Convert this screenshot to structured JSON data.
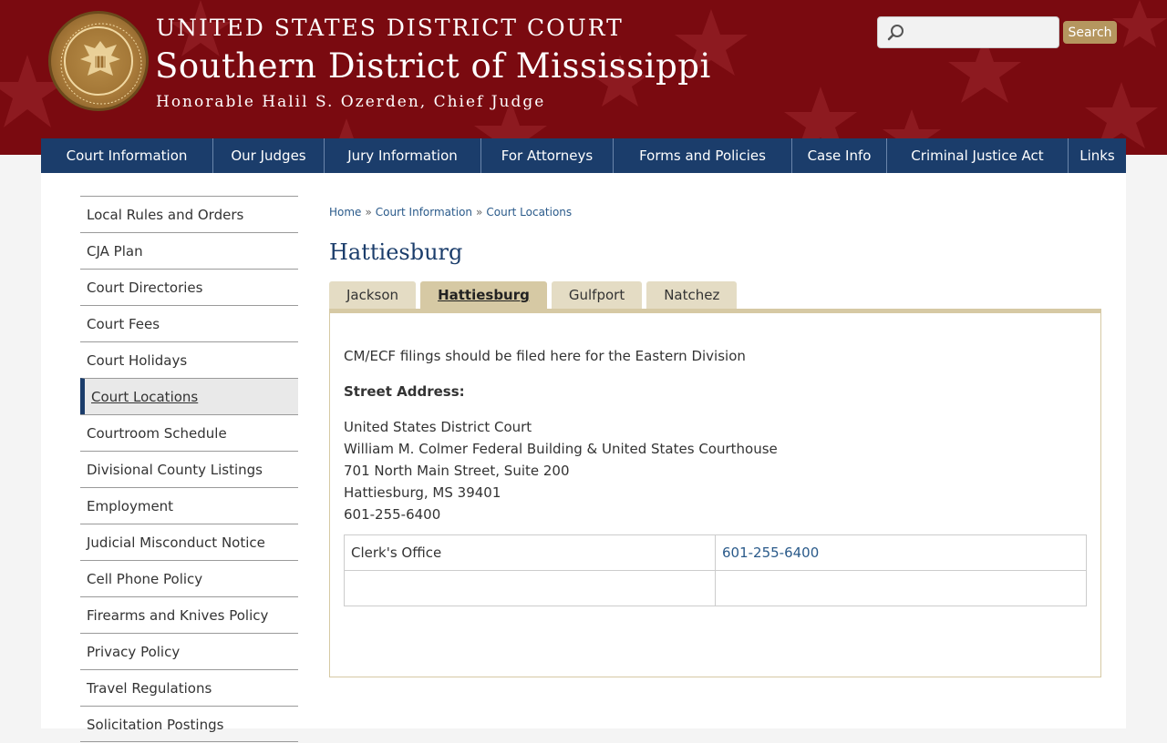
{
  "header": {
    "court_title": "UNITED STATES DISTRICT COURT",
    "district_title": "Southern District of Mississippi",
    "judge_line": "Honorable Halil S. Ozerden, Chief Judge",
    "seal_name": "seal-icon"
  },
  "search": {
    "placeholder": "",
    "value": "",
    "button_label": "Search"
  },
  "nav": {
    "items": [
      {
        "label": "Court Information"
      },
      {
        "label": "Our Judges"
      },
      {
        "label": "Jury Information"
      },
      {
        "label": "For Attorneys"
      },
      {
        "label": "Forms and Policies"
      },
      {
        "label": "Case Info"
      },
      {
        "label": "Criminal Justice Act"
      },
      {
        "label": "Links"
      }
    ]
  },
  "sidebar": {
    "items": [
      {
        "label": "Local Rules and Orders"
      },
      {
        "label": "CJA Plan"
      },
      {
        "label": "Court Directories"
      },
      {
        "label": "Court Fees"
      },
      {
        "label": "Court Holidays"
      },
      {
        "label": "Court Locations"
      },
      {
        "label": "Courtroom Schedule"
      },
      {
        "label": "Divisional County Listings"
      },
      {
        "label": "Employment"
      },
      {
        "label": "Judicial Misconduct Notice"
      },
      {
        "label": "Cell Phone Policy"
      },
      {
        "label": "Firearms and Knives Policy"
      },
      {
        "label": "Privacy Policy"
      },
      {
        "label": "Travel Regulations"
      },
      {
        "label": "Solicitation Postings"
      }
    ],
    "active_index": 5
  },
  "breadcrumb": {
    "items": [
      "Home",
      "Court Information",
      "Court Locations"
    ],
    "separator": "»"
  },
  "page_title": "Hattiesburg",
  "tabs": {
    "items": [
      {
        "label": "Jackson"
      },
      {
        "label": "Hattiesburg"
      },
      {
        "label": "Gulfport"
      },
      {
        "label": "Natchez"
      }
    ],
    "active_index": 1
  },
  "panel": {
    "intro": "CM/ECF filings should be filed here for the Eastern Division",
    "street_heading": "Street Address:",
    "address": [
      "United States District Court",
      "William M. Colmer Federal Building & United States Courthouse",
      "701 North Main Street, Suite 200",
      "Hattiesburg, MS  39401",
      "601-255-6400"
    ],
    "table": [
      {
        "label": "Clerk's Office",
        "phone": "601-255-6400"
      },
      {
        "label": "",
        "phone": ""
      }
    ]
  },
  "colors": {
    "header_red": "#7a0a10",
    "nav_blue": "#1b3d6b",
    "tab_tan": "#d6c9a4",
    "link_blue": "#2a5a8a",
    "search_button": "#b5965f"
  }
}
